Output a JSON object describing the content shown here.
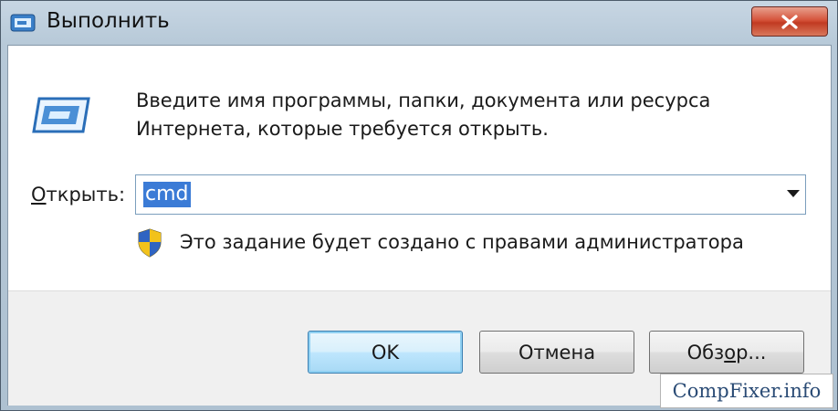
{
  "window": {
    "title": "Выполнить",
    "close_icon": "close-icon",
    "run_icon": "run-program-icon"
  },
  "content": {
    "description": "Введите имя программы, папки, документа или ресурса Интернета, которые требуется открыть.",
    "open_label_underlined": "О",
    "open_label_rest": "ткрыть:",
    "open_value": "cmd",
    "admin_note": "Это задание будет создано с правами администратора",
    "shield_icon": "uac-shield-icon"
  },
  "buttons": {
    "ok": "OK",
    "cancel": "Отмена",
    "browse_pre": "Обз",
    "browse_underlined": "о",
    "browse_post": "р..."
  },
  "watermark": "CompFixer.info",
  "colors": {
    "selection": "#3b7bd6",
    "close_button": "#c13a22",
    "default_button_border": "#3c7fb1"
  }
}
